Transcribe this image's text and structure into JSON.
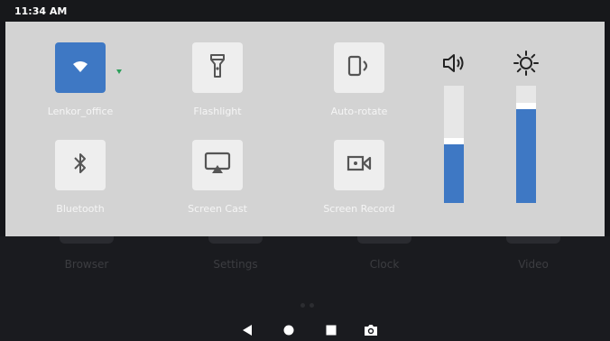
{
  "status_bar": {
    "time": "11:34 AM"
  },
  "quick_settings": {
    "tiles": [
      {
        "id": "wifi",
        "label": "Lenkor_office",
        "active": true,
        "icon": "wifi-icon"
      },
      {
        "id": "flashlight",
        "label": "Flashlight",
        "active": false,
        "icon": "flashlight-icon"
      },
      {
        "id": "autorotate",
        "label": "Auto-rotate",
        "active": false,
        "icon": "auto-rotate-icon"
      },
      {
        "id": "bluetooth",
        "label": "Bluetooth",
        "active": false,
        "icon": "bluetooth-icon"
      },
      {
        "id": "screencast",
        "label": "Screen Cast",
        "active": false,
        "icon": "screen-cast-icon"
      },
      {
        "id": "screenrecord",
        "label": "Screen Record",
        "active": false,
        "icon": "screen-record-icon"
      }
    ],
    "sliders": {
      "volume": {
        "level_percent": 55,
        "icon": "volume-icon"
      },
      "brightness": {
        "level_percent": 85,
        "icon": "brightness-icon"
      }
    }
  },
  "home_apps": [
    {
      "label": "Browser"
    },
    {
      "label": "Settings"
    },
    {
      "label": "Clock"
    },
    {
      "label": "Video"
    }
  ],
  "nav_bar": {
    "buttons": [
      "back-icon",
      "home-icon",
      "recents-icon",
      "screenshot-icon"
    ]
  },
  "colors": {
    "accent": "#3e78c4",
    "panel_bg": "#d3d3d3",
    "wifi_caret": "#2ca05a"
  }
}
